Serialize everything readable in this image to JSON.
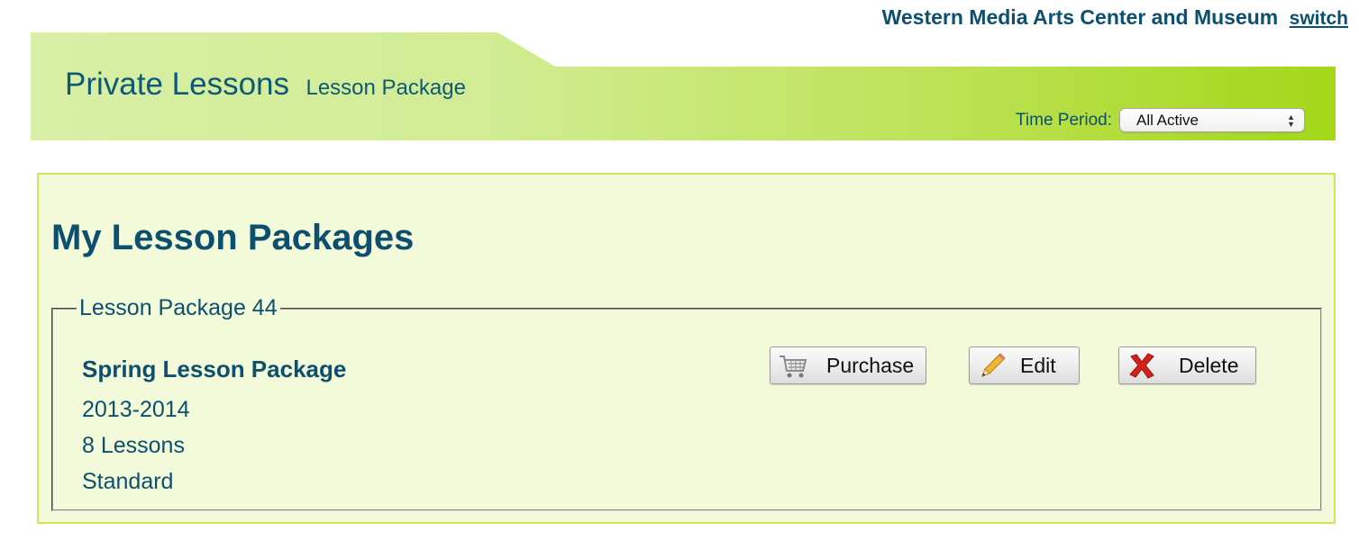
{
  "org": {
    "name": "Western Media Arts Center and Museum",
    "switch_label": "switch"
  },
  "header": {
    "title": "Private Lessons",
    "subtitle": "Lesson Package",
    "time_period_label": "Time Period:",
    "time_period_value": "All Active"
  },
  "main": {
    "heading": "My Lesson Packages",
    "package": {
      "legend": "Lesson Package 44",
      "name": "Spring Lesson Package",
      "year": "2013-2014",
      "lessons": "8 Lessons",
      "type": "Standard",
      "buttons": {
        "purchase": "Purchase",
        "edit": "Edit",
        "delete": "Delete"
      }
    }
  },
  "colors": {
    "text_primary": "#0d4f6e",
    "banner_light": "#d6eea0",
    "banner_bright": "#a4d81a",
    "panel_bg": "#f2fad9",
    "panel_border": "#c9e85a",
    "delete_red": "#d8201a"
  },
  "icons": {
    "purchase": "shopping-cart-icon",
    "edit": "pencil-icon",
    "delete": "red-x-icon"
  }
}
